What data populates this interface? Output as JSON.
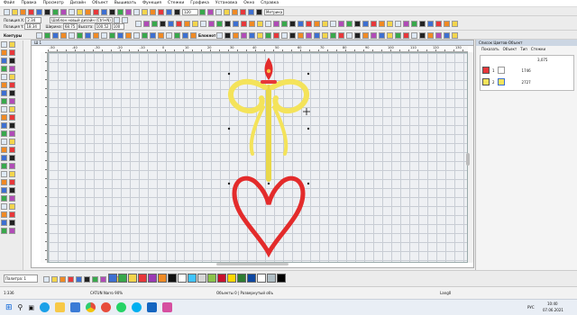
{
  "menu": [
    "Файл",
    "Правка",
    "Просмотр",
    "Дизайн",
    "Объект",
    "Вышивать",
    "Функция",
    "Стежки",
    "Графика",
    "Установка",
    "Окно",
    "Справка"
  ],
  "toolbar": {
    "zoom_value": "120",
    "metric_label": "Метрика",
    "pos_x_label": "Позиция Х:",
    "pos_y_label": "Позиция Y:",
    "pos_x_value": "2.34",
    "pos_y_value": "18.34",
    "width_label": "Ширина:",
    "height_label": "Высота:",
    "width_value": "68.75",
    "height_value": "100.52",
    "design_name": "Шаблон новый дизайн (Ctrl+N)",
    "scale_value": "100",
    "mode_label": "Блокнот",
    "lettering_label": "Буквенное"
  },
  "contours_label": "Контуры",
  "document": {
    "title": "Ш 1"
  },
  "ruler": {
    "h": [
      "-50",
      "-40",
      "-30",
      "-20",
      "-10",
      "0",
      "10",
      "20",
      "30",
      "40",
      "50",
      "60",
      "70",
      "80",
      "90",
      "100",
      "110",
      "120",
      "130"
    ]
  },
  "right_panel": {
    "title": "Список Цветов-Объект",
    "tabs": [
      "Показать",
      "Объект",
      "Тип",
      "Стежки"
    ],
    "rows": [
      {
        "n": "1",
        "stitches": "1746",
        "color": "#e7373a"
      },
      {
        "n": "2",
        "stitches": "2727",
        "color": "#f4e35a"
      }
    ],
    "total": "3,075"
  },
  "bottom": {
    "palette_label": "Палитра: 1",
    "colors": [
      "#3d6fd1",
      "#38a84b",
      "#f4d54c",
      "#e7373a",
      "#9b3ab4",
      "#f08a24",
      "#111111",
      "#ffffff",
      "#40c4ff",
      "#d6d6d6",
      "#8bc34a",
      "#c8102e",
      "#ffd700",
      "#2e7d32",
      "#0d47a1",
      "#ffffff",
      "#b0bec5",
      "#000000"
    ]
  },
  "status": {
    "left": "1:336",
    "mid": "CATUN Narro 90%",
    "objects": "Объекты 0 | Развернутый объ",
    "right": "Lang0"
  },
  "taskbar": {
    "time": "10:40",
    "date": "07.06.2021",
    "lang": "РУС"
  }
}
